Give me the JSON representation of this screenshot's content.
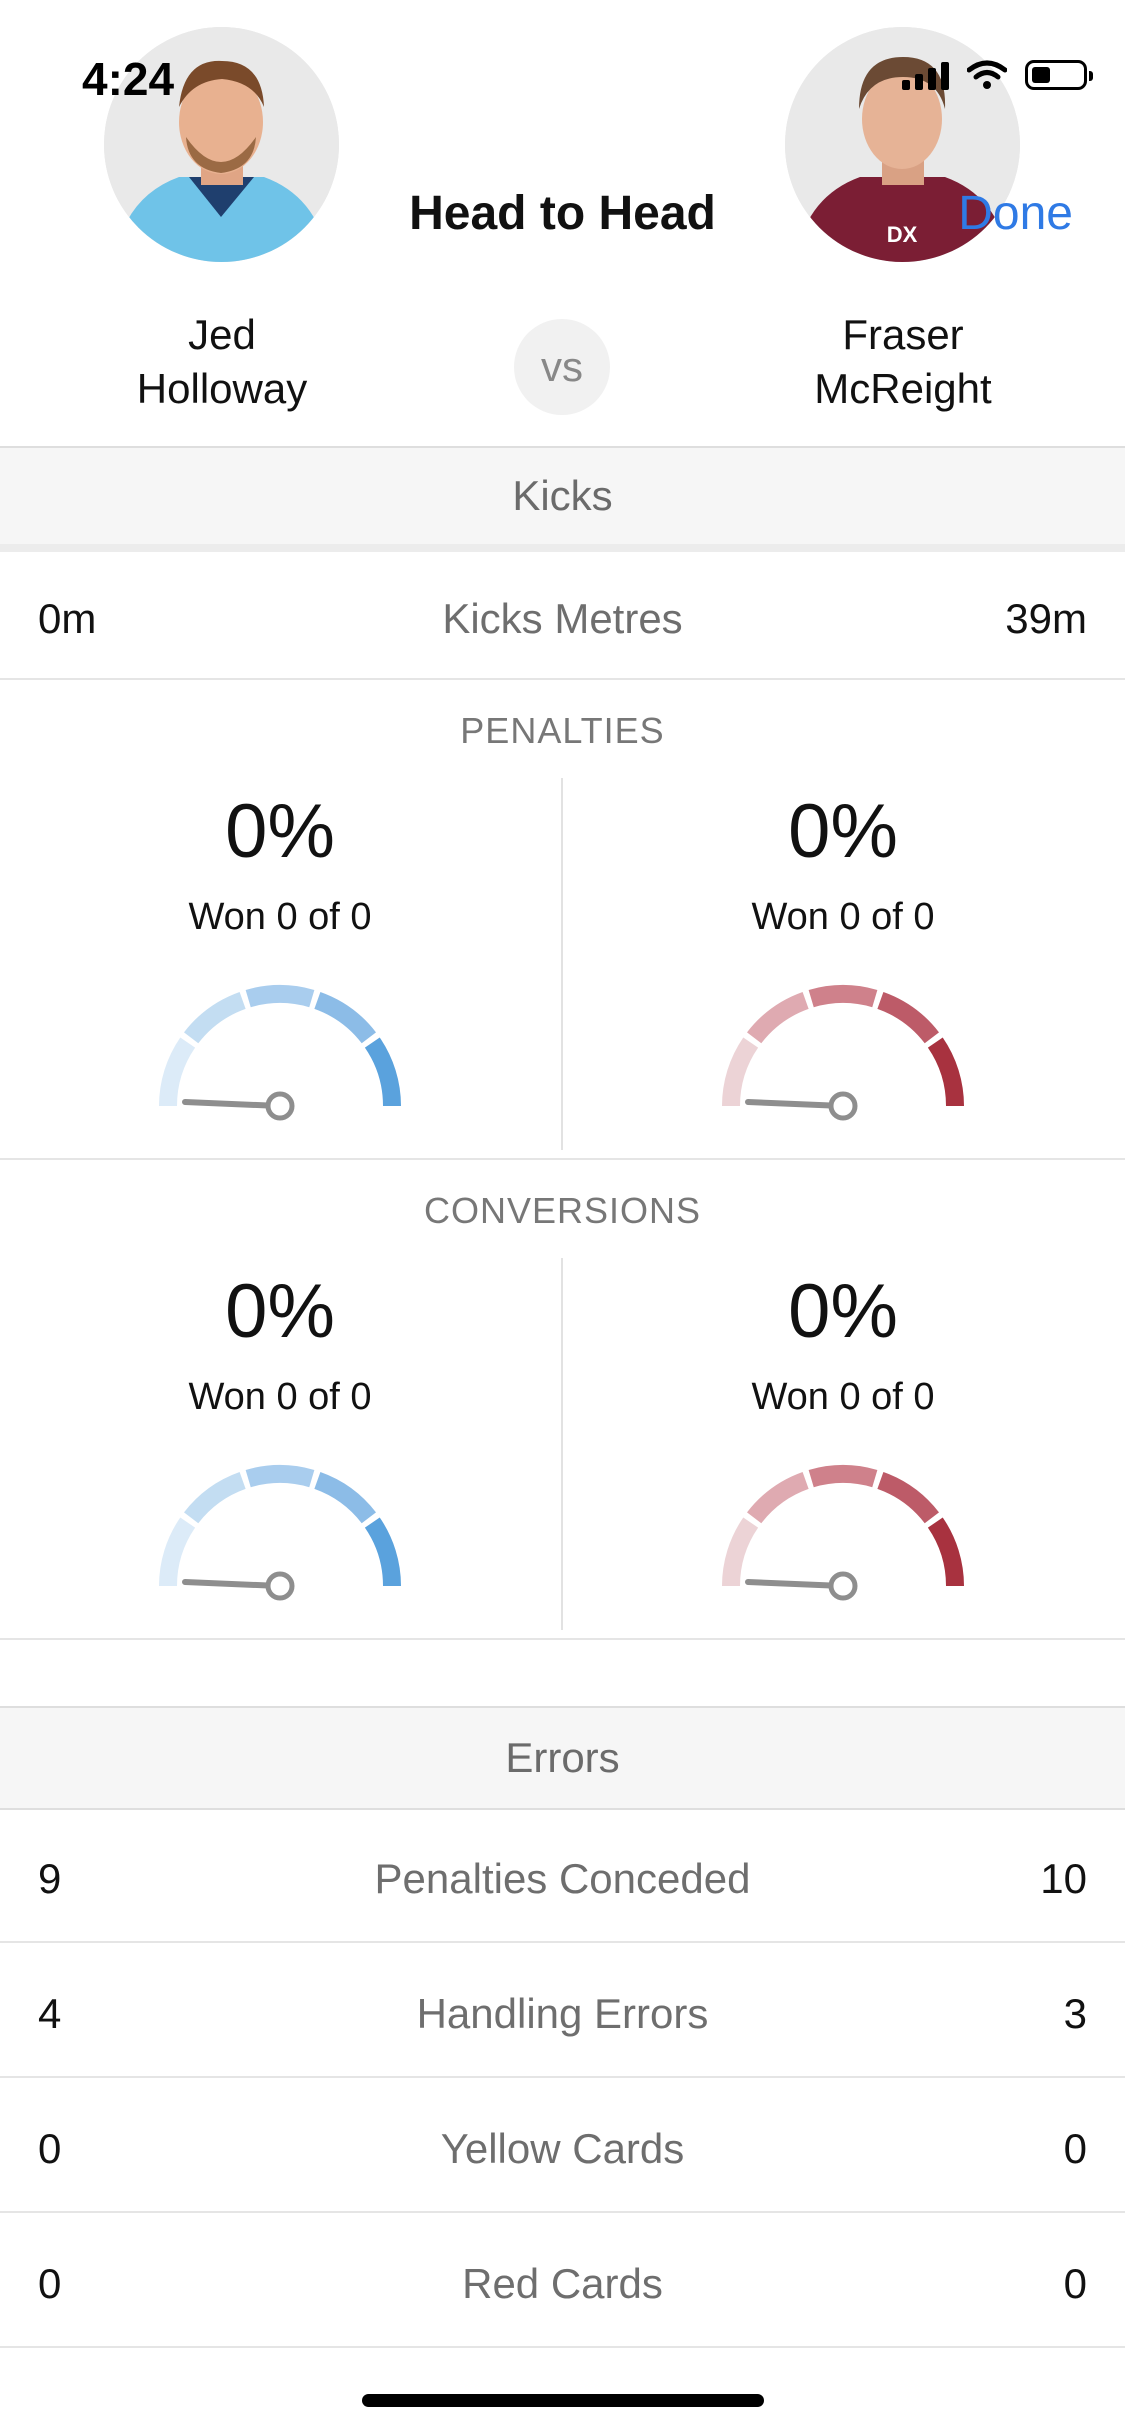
{
  "status": {
    "time": "4:24"
  },
  "header": {
    "title": "Head to Head",
    "done": "Done",
    "vs": "vs",
    "left_player": {
      "first": "Jed",
      "last": "Holloway"
    },
    "right_player": {
      "first": "Fraser",
      "last": "McReight"
    }
  },
  "kicks": {
    "section": "Kicks",
    "metres": {
      "label": "Kicks Metres",
      "left": "0m",
      "right": "39m"
    }
  },
  "penalties": {
    "title": "PENALTIES",
    "left": {
      "pct": "0%",
      "won": "Won 0 of 0",
      "value": 0
    },
    "right": {
      "pct": "0%",
      "won": "Won 0 of 0",
      "value": 0
    }
  },
  "conversions": {
    "title": "CONVERSIONS",
    "left": {
      "pct": "0%",
      "won": "Won 0 of 0",
      "value": 0
    },
    "right": {
      "pct": "0%",
      "won": "Won 0 of 0",
      "value": 0
    }
  },
  "errors": {
    "section": "Errors",
    "rows": [
      {
        "label": "Penalties Conceded",
        "left": "9",
        "right": "10"
      },
      {
        "label": "Handling Errors",
        "left": "4",
        "right": "3"
      },
      {
        "label": "Yellow Cards",
        "left": "0",
        "right": "0"
      },
      {
        "label": "Red Cards",
        "left": "0",
        "right": "0"
      }
    ]
  },
  "colors": {
    "accent": "#2f7ae5",
    "left_team": [
      "#dcebf8",
      "#c3ddf2",
      "#a9cdee",
      "#8cbce7",
      "#5aa2dd"
    ],
    "right_team": [
      "#ecd3d6",
      "#dfaab1",
      "#cf818b",
      "#bd5b68",
      "#a8323f"
    ]
  }
}
